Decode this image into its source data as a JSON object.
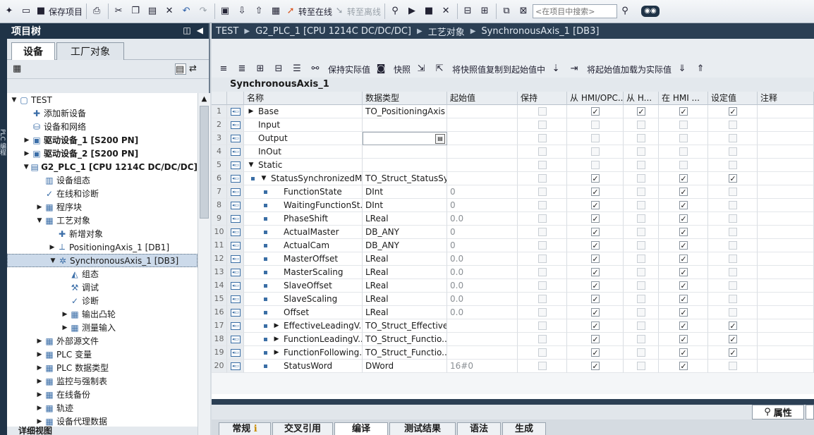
{
  "toolbar": {
    "save_project": "保存项目",
    "go_online": "转至在线",
    "go_offline": "转至离线",
    "search_placeholder": "<在项目中搜索>"
  },
  "left_strip_label": "PLC 编程",
  "tree": {
    "title": "项目树",
    "tab_devices": "设备",
    "tab_plant": "工厂对象",
    "items": [
      {
        "label": "TEST",
        "indent": 0,
        "arrow": "▼",
        "icon": "project-icon",
        "glyph": "▢",
        "bold": false
      },
      {
        "label": "添加新设备",
        "indent": 1,
        "arrow": "",
        "icon": "add-device-icon",
        "glyph": "✚",
        "bold": false
      },
      {
        "label": "设备和网络",
        "indent": 1,
        "arrow": "",
        "icon": "network-icon",
        "glyph": "⛁",
        "bold": false
      },
      {
        "label": "驱动设备_1 [S200 PN]",
        "indent": 1,
        "arrow": "▶",
        "icon": "drive-icon",
        "glyph": "▣",
        "bold": true
      },
      {
        "label": "驱动设备_2 [S200 PN]",
        "indent": 1,
        "arrow": "▶",
        "icon": "drive-icon",
        "glyph": "▣",
        "bold": true
      },
      {
        "label": "G2_PLC_1 [CPU 1214C DC/DC/DC]",
        "indent": 1,
        "arrow": "▼",
        "icon": "plc-icon",
        "glyph": "▤",
        "bold": true
      },
      {
        "label": "设备组态",
        "indent": 2,
        "arrow": "",
        "icon": "device-config-icon",
        "glyph": "▥",
        "bold": false
      },
      {
        "label": "在线和诊断",
        "indent": 2,
        "arrow": "",
        "icon": "diagnostics-icon",
        "glyph": "✓",
        "bold": false
      },
      {
        "label": "程序块",
        "indent": 2,
        "arrow": "▶",
        "icon": "folder-icon",
        "glyph": "▦",
        "bold": false
      },
      {
        "label": "工艺对象",
        "indent": 2,
        "arrow": "▼",
        "icon": "tech-objects-icon",
        "glyph": "▦",
        "bold": false
      },
      {
        "label": "新增对象",
        "indent": 3,
        "arrow": "",
        "icon": "add-object-icon",
        "glyph": "✚",
        "bold": false
      },
      {
        "label": "PositioningAxis_1 [DB1]",
        "indent": 3,
        "arrow": "▶",
        "icon": "axis-icon",
        "glyph": "⟂",
        "bold": false
      },
      {
        "label": "SynchronousAxis_1 [DB3]",
        "indent": 3,
        "arrow": "▼",
        "icon": "sync-axis-icon",
        "glyph": "✲",
        "bold": false,
        "selected": true
      },
      {
        "label": "组态",
        "indent": 4,
        "arrow": "",
        "icon": "config-icon",
        "glyph": "◭",
        "bold": false
      },
      {
        "label": "调试",
        "indent": 4,
        "arrow": "",
        "icon": "commissioning-icon",
        "glyph": "⚒",
        "bold": false
      },
      {
        "label": "诊断",
        "indent": 4,
        "arrow": "",
        "icon": "diagnostics-icon",
        "glyph": "✓",
        "bold": false
      },
      {
        "label": "输出凸轮",
        "indent": 4,
        "arrow": "▶",
        "icon": "folder-icon",
        "glyph": "▦",
        "bold": false
      },
      {
        "label": "测量输入",
        "indent": 4,
        "arrow": "▶",
        "icon": "folder-icon",
        "glyph": "▦",
        "bold": false
      },
      {
        "label": "外部源文件",
        "indent": 2,
        "arrow": "▶",
        "icon": "folder-icon",
        "glyph": "▦",
        "bold": false
      },
      {
        "label": "PLC 变量",
        "indent": 2,
        "arrow": "▶",
        "icon": "plc-tags-icon",
        "glyph": "▦",
        "bold": false
      },
      {
        "label": "PLC 数据类型",
        "indent": 2,
        "arrow": "▶",
        "icon": "plc-datatype-icon",
        "glyph": "▦",
        "bold": false
      },
      {
        "label": "监控与强制表",
        "indent": 2,
        "arrow": "▶",
        "icon": "watch-table-icon",
        "glyph": "▦",
        "bold": false
      },
      {
        "label": "在线备份",
        "indent": 2,
        "arrow": "▶",
        "icon": "backup-icon",
        "glyph": "▦",
        "bold": false
      },
      {
        "label": "轨迹",
        "indent": 2,
        "arrow": "▶",
        "icon": "trace-icon",
        "glyph": "▦",
        "bold": false
      },
      {
        "label": "设备代理数据",
        "indent": 2,
        "arrow": "▶",
        "icon": "proxy-data-icon",
        "glyph": "▦",
        "bold": false
      }
    ],
    "details_view": "详细视图"
  },
  "breadcrumb": [
    "TEST",
    "G2_PLC_1 [CPU 1214C DC/DC/DC]",
    "工艺对象",
    "SynchronousAxis_1 [DB3]"
  ],
  "editor": {
    "keep_actual": "保持实际值",
    "snapshot": "快照",
    "copy_snapshot": "将快照值复制到起始值中",
    "load_start": "将起始值加载为实际值",
    "db_title": "SynchronousAxis_1"
  },
  "grid": {
    "headers": {
      "name": "名称",
      "type": "数据类型",
      "start": "起始值",
      "keep": "保持",
      "hmi": "从 HMI/OPC...",
      "h": "从 H...",
      "inhmi": "在 HMI ...",
      "set": "设定值",
      "cmt": "注释"
    },
    "rows": [
      {
        "num": "1",
        "level": 0,
        "arrow": "▶",
        "name": "Base",
        "type": "TO_PositioningAxis",
        "start": "",
        "hmi": true,
        "h": true,
        "inhmi": true,
        "set": true,
        "dis": false
      },
      {
        "num": "2",
        "level": 0,
        "arrow": "",
        "name": "Input",
        "type": "",
        "start": "",
        "hmi": false,
        "h": false,
        "inhmi": false,
        "set": false,
        "dis": true
      },
      {
        "num": "3",
        "level": 0,
        "arrow": "",
        "name": "Output",
        "type": "",
        "start": "",
        "hmi": false,
        "h": false,
        "inhmi": false,
        "set": false,
        "dis": true,
        "dropdown": true
      },
      {
        "num": "4",
        "level": 0,
        "arrow": "",
        "name": "InOut",
        "type": "",
        "start": "",
        "hmi": false,
        "h": false,
        "inhmi": false,
        "set": false,
        "dis": true
      },
      {
        "num": "5",
        "level": 0,
        "arrow": "▼",
        "name": "Static",
        "type": "",
        "start": "",
        "hmi": false,
        "h": false,
        "inhmi": false,
        "set": false,
        "dis": true
      },
      {
        "num": "6",
        "level": 1,
        "arrow": "▼",
        "name": "StatusSynchronizedM...",
        "type": "TO_Struct_StatusSy...",
        "start": "",
        "hmi": true,
        "h": false,
        "inhmi": true,
        "set": true,
        "dis": false
      },
      {
        "num": "7",
        "level": 2,
        "arrow": "",
        "name": "FunctionState",
        "type": "DInt",
        "start": "0",
        "hmi": true,
        "h": false,
        "inhmi": true,
        "set": false,
        "dis": false
      },
      {
        "num": "8",
        "level": 2,
        "arrow": "",
        "name": "WaitingFunctionSt...",
        "type": "DInt",
        "start": "0",
        "hmi": true,
        "h": false,
        "inhmi": true,
        "set": false,
        "dis": false
      },
      {
        "num": "9",
        "level": 2,
        "arrow": "",
        "name": "PhaseShift",
        "type": "LReal",
        "start": "0.0",
        "hmi": true,
        "h": false,
        "inhmi": true,
        "set": false,
        "dis": false
      },
      {
        "num": "10",
        "level": 2,
        "arrow": "",
        "name": "ActualMaster",
        "type": "DB_ANY",
        "start": "0",
        "hmi": true,
        "h": false,
        "inhmi": true,
        "set": false,
        "dis": false
      },
      {
        "num": "11",
        "level": 2,
        "arrow": "",
        "name": "ActualCam",
        "type": "DB_ANY",
        "start": "0",
        "hmi": true,
        "h": false,
        "inhmi": true,
        "set": false,
        "dis": false
      },
      {
        "num": "12",
        "level": 2,
        "arrow": "",
        "name": "MasterOffset",
        "type": "LReal",
        "start": "0.0",
        "hmi": true,
        "h": false,
        "inhmi": true,
        "set": false,
        "dis": false
      },
      {
        "num": "13",
        "level": 2,
        "arrow": "",
        "name": "MasterScaling",
        "type": "LReal",
        "start": "0.0",
        "hmi": true,
        "h": false,
        "inhmi": true,
        "set": false,
        "dis": false
      },
      {
        "num": "14",
        "level": 2,
        "arrow": "",
        "name": "SlaveOffset",
        "type": "LReal",
        "start": "0.0",
        "hmi": true,
        "h": false,
        "inhmi": true,
        "set": false,
        "dis": false
      },
      {
        "num": "15",
        "level": 2,
        "arrow": "",
        "name": "SlaveScaling",
        "type": "LReal",
        "start": "0.0",
        "hmi": true,
        "h": false,
        "inhmi": true,
        "set": false,
        "dis": false
      },
      {
        "num": "16",
        "level": 2,
        "arrow": "",
        "name": "Offset",
        "type": "LReal",
        "start": "0.0",
        "hmi": true,
        "h": false,
        "inhmi": true,
        "set": false,
        "dis": false
      },
      {
        "num": "17",
        "level": 2,
        "arrow": "▶",
        "name": "EffectiveLeadingV...",
        "type": "TO_Struct_Effective...",
        "start": "",
        "hmi": true,
        "h": false,
        "inhmi": true,
        "set": true,
        "dis": false
      },
      {
        "num": "18",
        "level": 2,
        "arrow": "▶",
        "name": "FunctionLeadingV...",
        "type": "TO_Struct_Functio...",
        "start": "",
        "hmi": true,
        "h": false,
        "inhmi": true,
        "set": true,
        "dis": false
      },
      {
        "num": "19",
        "level": 2,
        "arrow": "▶",
        "name": "FunctionFollowing...",
        "type": "TO_Struct_Functio...",
        "start": "",
        "hmi": true,
        "h": false,
        "inhmi": true,
        "set": true,
        "dis": false
      },
      {
        "num": "20",
        "level": 2,
        "arrow": "",
        "name": "StatusWord",
        "type": "DWord",
        "start": "16#0",
        "hmi": true,
        "h": false,
        "inhmi": true,
        "set": false,
        "dis": false
      }
    ]
  },
  "inspector": {
    "properties": "属性",
    "tabs": [
      "常规",
      "交叉引用",
      "编译",
      "测试结果",
      "语法",
      "生成"
    ],
    "active_tab": 2
  },
  "colors": {
    "accent_dark": "#1f3347",
    "selection": "#ccdaea",
    "grid_line": "#d9dde2"
  }
}
